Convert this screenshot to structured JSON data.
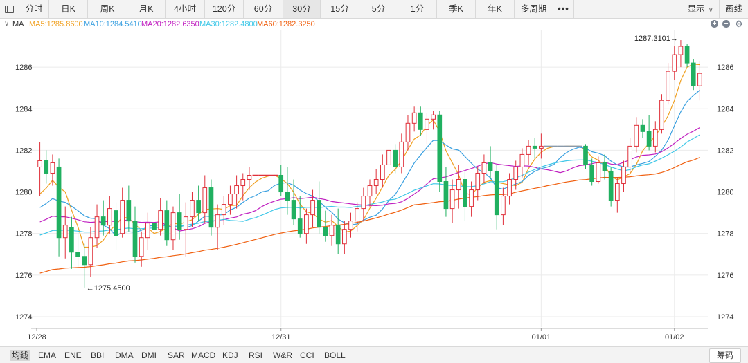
{
  "toolbar": {
    "tabs": [
      "分时",
      "日K",
      "周K",
      "月K",
      "4小时",
      "120分",
      "60分",
      "30分",
      "15分",
      "5分",
      "1分",
      "季K",
      "年K",
      "多周期"
    ],
    "active_tab": "30分",
    "more": "•••",
    "display_label": "显示",
    "draw_label": "画线"
  },
  "ma_legend": {
    "title": "MA",
    "ma5": "MA5:1285.8600",
    "ma10": "MA10:1284.5410",
    "ma20": "MA20:1282.6350",
    "ma30": "MA30:1282.4800",
    "ma60": "MA60:1282.3250",
    "colors": {
      "ma5": "#f0a020",
      "ma10": "#3aa0e0",
      "ma20": "#c020c0",
      "ma30": "#40c8e8",
      "ma60": "#f06010"
    }
  },
  "colors": {
    "up": "#e0303a",
    "down": "#20b060",
    "grid": "#ebebeb",
    "flat": "#8899aa"
  },
  "bottom": {
    "indicators": [
      "均线",
      "EMA",
      "ENE",
      "BBI",
      "DMA",
      "DMI",
      "SAR",
      "MACD",
      "KDJ",
      "RSI",
      "W&R",
      "CCI",
      "BOLL"
    ],
    "active": "均线",
    "chips": "筹码"
  },
  "chart_data": {
    "type": "candlestick",
    "y_ticks": [
      "1274",
      "1276",
      "1278",
      "1280",
      "1282",
      "1284",
      "1286"
    ],
    "ylim": [
      1273.5,
      1287.8
    ],
    "x_ticks": [
      "12/28",
      "12/31",
      "01/01",
      "01/02"
    ],
    "annotations": {
      "high": "1287.3101",
      "low": "1275.4500"
    },
    "candles": [
      [
        1281.2,
        1282.4,
        1279.8,
        1281.5
      ],
      [
        1281.5,
        1282.0,
        1280.4,
        1280.9
      ],
      [
        1280.9,
        1281.8,
        1280.3,
        1281.4
      ],
      [
        1281.2,
        1281.6,
        1276.9,
        1277.8
      ],
      [
        1277.8,
        1279.3,
        1276.8,
        1278.4
      ],
      [
        1278.3,
        1278.8,
        1276.3,
        1277.1
      ],
      [
        1277.1,
        1278.2,
        1276.4,
        1276.9
      ],
      [
        1276.9,
        1277.5,
        1275.4,
        1276.5
      ],
      [
        1276.5,
        1278.3,
        1275.9,
        1277.8
      ],
      [
        1277.8,
        1279.4,
        1277.3,
        1278.8
      ],
      [
        1278.8,
        1279.6,
        1277.9,
        1278.4
      ],
      [
        1278.4,
        1279.8,
        1278.0,
        1279.2
      ],
      [
        1279.1,
        1279.5,
        1277.2,
        1277.9
      ],
      [
        1278.0,
        1280.2,
        1277.8,
        1279.6
      ],
      [
        1279.6,
        1280.3,
        1278.1,
        1278.6
      ],
      [
        1278.6,
        1279.3,
        1276.6,
        1276.9
      ],
      [
        1276.9,
        1278.1,
        1276.4,
        1277.8
      ],
      [
        1277.8,
        1279.0,
        1277.2,
        1278.5
      ],
      [
        1278.5,
        1279.6,
        1277.3,
        1278.2
      ],
      [
        1278.2,
        1279.7,
        1277.9,
        1279.1
      ],
      [
        1279.1,
        1279.6,
        1277.4,
        1277.7
      ],
      [
        1277.7,
        1279.3,
        1277.2,
        1279.0
      ],
      [
        1279.0,
        1279.9,
        1277.7,
        1278.2
      ],
      [
        1278.2,
        1279.5,
        1276.9,
        1278.8
      ],
      [
        1278.8,
        1280.0,
        1278.3,
        1279.6
      ],
      [
        1279.6,
        1280.3,
        1278.6,
        1279.0
      ],
      [
        1279.0,
        1280.8,
        1278.5,
        1280.2
      ],
      [
        1280.2,
        1280.6,
        1277.9,
        1278.3
      ],
      [
        1278.3,
        1279.4,
        1277.2,
        1278.9
      ],
      [
        1278.9,
        1279.8,
        1278.4,
        1279.4
      ],
      [
        1279.4,
        1280.3,
        1278.9,
        1279.9
      ],
      [
        1279.9,
        1280.8,
        1279.2,
        1280.3
      ],
      [
        1280.3,
        1280.9,
        1279.6,
        1280.6
      ],
      [
        1280.6,
        1281.2,
        1280.1,
        1280.8
      ],
      [
        1280.8,
        1280.8,
        1280.8,
        1280.8
      ],
      [
        1280.8,
        1280.8,
        1280.8,
        1280.8
      ],
      [
        1280.8,
        1280.8,
        1280.8,
        1280.8
      ],
      [
        1280.8,
        1280.8,
        1280.8,
        1280.8
      ],
      [
        1280.8,
        1281.3,
        1279.8,
        1280.0
      ],
      [
        1280.0,
        1281.2,
        1278.9,
        1279.6
      ],
      [
        1279.6,
        1280.6,
        1278.4,
        1278.7
      ],
      [
        1278.7,
        1279.8,
        1277.8,
        1278.0
      ],
      [
        1278.0,
        1279.2,
        1277.5,
        1278.9
      ],
      [
        1278.9,
        1280.1,
        1278.3,
        1279.6
      ],
      [
        1279.6,
        1280.5,
        1278.0,
        1278.3
      ],
      [
        1278.3,
        1279.1,
        1277.6,
        1277.9
      ],
      [
        1277.9,
        1278.9,
        1277.4,
        1278.4
      ],
      [
        1278.4,
        1279.2,
        1277.0,
        1277.5
      ],
      [
        1277.5,
        1278.6,
        1277.0,
        1278.2
      ],
      [
        1278.2,
        1279.0,
        1277.8,
        1278.6
      ],
      [
        1278.6,
        1279.5,
        1278.1,
        1279.2
      ],
      [
        1279.2,
        1280.2,
        1278.6,
        1279.8
      ],
      [
        1279.8,
        1280.6,
        1279.3,
        1280.3
      ],
      [
        1280.3,
        1281.1,
        1279.9,
        1280.6
      ],
      [
        1280.6,
        1281.8,
        1280.2,
        1281.3
      ],
      [
        1281.3,
        1282.6,
        1280.8,
        1282.0
      ],
      [
        1282.0,
        1282.3,
        1280.9,
        1281.2
      ],
      [
        1281.2,
        1282.8,
        1280.9,
        1282.4
      ],
      [
        1282.4,
        1283.7,
        1282.0,
        1283.3
      ],
      [
        1283.3,
        1284.1,
        1282.9,
        1283.8
      ],
      [
        1283.8,
        1284.1,
        1282.7,
        1283.0
      ],
      [
        1283.0,
        1283.8,
        1282.3,
        1283.5
      ],
      [
        1283.5,
        1283.9,
        1283.0,
        1283.7
      ],
      [
        1283.7,
        1283.9,
        1280.0,
        1280.5
      ],
      [
        1280.5,
        1281.2,
        1278.8,
        1279.2
      ],
      [
        1279.2,
        1280.6,
        1278.5,
        1280.1
      ],
      [
        1280.1,
        1281.3,
        1279.2,
        1280.6
      ],
      [
        1280.6,
        1281.0,
        1278.6,
        1279.3
      ],
      [
        1279.3,
        1280.5,
        1278.8,
        1280.1
      ],
      [
        1280.1,
        1281.2,
        1279.6,
        1280.9
      ],
      [
        1280.9,
        1281.8,
        1280.4,
        1281.4
      ],
      [
        1281.4,
        1282.2,
        1280.6,
        1281.0
      ],
      [
        1281.0,
        1281.3,
        1278.2,
        1278.9
      ],
      [
        1278.9,
        1280.2,
        1278.4,
        1279.8
      ],
      [
        1279.8,
        1280.9,
        1279.4,
        1280.6
      ],
      [
        1280.6,
        1281.5,
        1280.1,
        1281.2
      ],
      [
        1281.2,
        1282.1,
        1280.7,
        1281.8
      ],
      [
        1281.8,
        1282.5,
        1281.3,
        1282.2
      ],
      [
        1282.2,
        1282.6,
        1281.6,
        1282.1
      ],
      [
        1282.1,
        1282.8,
        1281.6,
        1282.2
      ],
      [
        1282.2,
        1282.2,
        1282.2,
        1282.2
      ],
      [
        1282.2,
        1282.2,
        1282.2,
        1282.2
      ],
      [
        1282.2,
        1282.2,
        1282.2,
        1282.2
      ],
      [
        1282.2,
        1282.2,
        1282.2,
        1282.2
      ],
      [
        1282.2,
        1282.2,
        1282.2,
        1282.2
      ],
      [
        1282.2,
        1282.2,
        1282.2,
        1282.2
      ],
      [
        1282.2,
        1282.3,
        1281.1,
        1281.3
      ],
      [
        1281.3,
        1281.6,
        1280.3,
        1280.5
      ],
      [
        1280.5,
        1281.7,
        1280.4,
        1281.4
      ],
      [
        1281.4,
        1281.8,
        1280.6,
        1281.0
      ],
      [
        1281.0,
        1281.2,
        1279.3,
        1279.6
      ],
      [
        1279.6,
        1280.7,
        1279.0,
        1280.4
      ],
      [
        1280.4,
        1281.5,
        1280.0,
        1281.2
      ],
      [
        1281.2,
        1282.6,
        1280.9,
        1282.2
      ],
      [
        1282.2,
        1283.6,
        1281.9,
        1283.2
      ],
      [
        1283.2,
        1283.5,
        1282.6,
        1282.9
      ],
      [
        1282.9,
        1283.7,
        1282.0,
        1282.2
      ],
      [
        1282.2,
        1283.4,
        1281.9,
        1283.0
      ],
      [
        1283.0,
        1284.7,
        1282.8,
        1284.4
      ],
      [
        1284.4,
        1286.2,
        1284.2,
        1285.8
      ],
      [
        1285.8,
        1287.0,
        1285.4,
        1286.6
      ],
      [
        1286.6,
        1287.3,
        1286.0,
        1287.0
      ],
      [
        1287.0,
        1287.1,
        1286.0,
        1286.2
      ],
      [
        1286.2,
        1286.4,
        1284.9,
        1285.1
      ],
      [
        1285.1,
        1286.3,
        1284.4,
        1285.7
      ]
    ],
    "flat_segments": [
      [
        33,
        37
      ],
      [
        79,
        86
      ]
    ],
    "gaps_after": [
      37,
      86
    ],
    "x_tick_index": [
      0,
      38,
      79,
      100
    ]
  }
}
